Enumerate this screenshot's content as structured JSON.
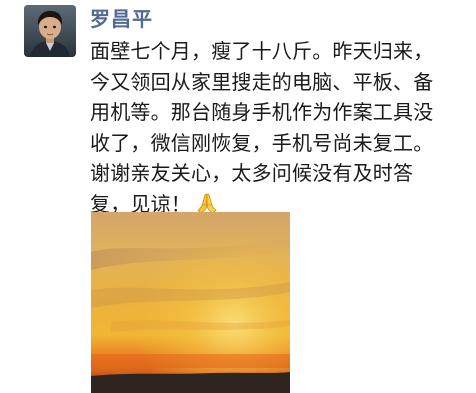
{
  "post": {
    "author": "罗昌平",
    "lines": [
      "面壁七个月，瘦了十八斤。昨天归来，",
      "今又领回从家里搜走的电脑、平板、备",
      "用机等。那台随身手机作为作案工具没",
      "收了，微信刚恢复，手机号尚未复工。",
      "谢谢亲友关心，太多问候没有及时答",
      "复，见谅！"
    ]
  },
  "icons": {
    "emoji": "folded-hands-icon",
    "avatar": "avatar-child-photo"
  },
  "colors": {
    "author_name": "#506a93",
    "text": "#1a1a1a",
    "sky_top": "#e2b25a",
    "sky_glow": "#f2c23a",
    "sky_band": "#e8701d"
  }
}
